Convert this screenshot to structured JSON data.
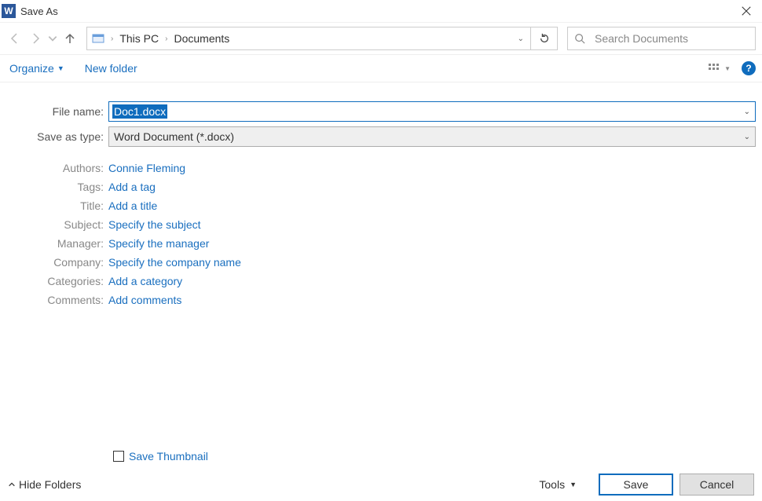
{
  "title": "Save As",
  "breadcrumbs": {
    "root": "This PC",
    "folder": "Documents"
  },
  "search": {
    "placeholder": "Search Documents"
  },
  "toolbar": {
    "organize": "Organize",
    "newfolder": "New folder"
  },
  "fields": {
    "filename_label": "File name:",
    "filename_value": "Doc1.docx",
    "type_label": "Save as type:",
    "type_value": "Word Document (*.docx)"
  },
  "props": {
    "authors_label": "Authors:",
    "authors_value": "Connie Fleming",
    "tags_label": "Tags:",
    "tags_value": "Add a tag",
    "title_label": "Title:",
    "title_value": "Add a title",
    "subject_label": "Subject:",
    "subject_value": "Specify the subject",
    "manager_label": "Manager:",
    "manager_value": "Specify the manager",
    "company_label": "Company:",
    "company_value": "Specify the company name",
    "categories_label": "Categories:",
    "categories_value": "Add a category",
    "comments_label": "Comments:",
    "comments_value": "Add comments"
  },
  "thumbnail_label": "Save Thumbnail",
  "footer": {
    "hide_folders": "Hide Folders",
    "tools": "Tools",
    "save": "Save",
    "cancel": "Cancel"
  }
}
